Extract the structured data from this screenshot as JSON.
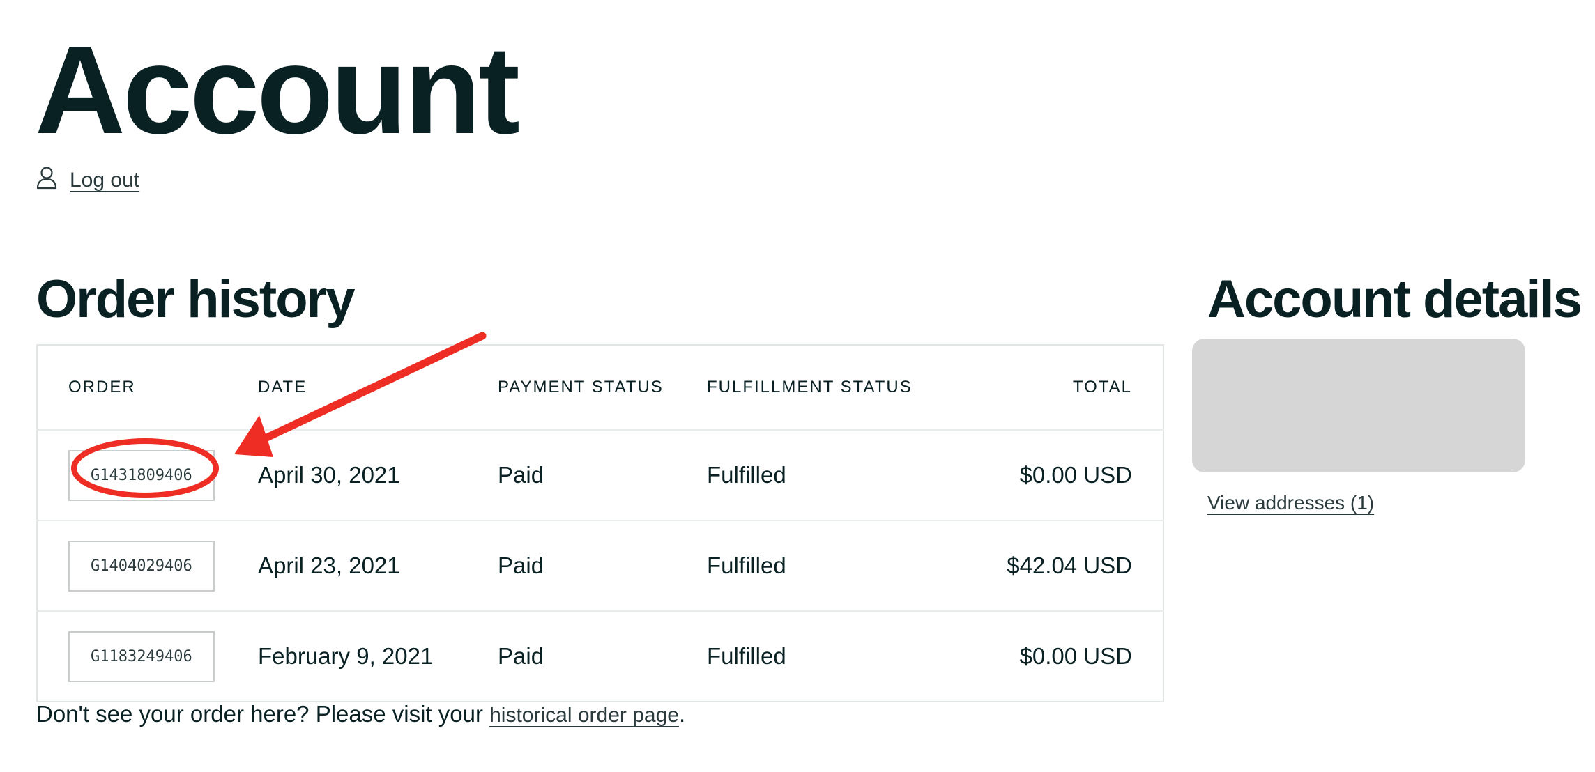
{
  "page": {
    "title": "Account"
  },
  "logout": {
    "icon": "user-icon",
    "label": "Log out"
  },
  "order_history": {
    "title": "Order history",
    "columns": {
      "order": "ORDER",
      "date": "DATE",
      "payment_status": "PAYMENT STATUS",
      "fulfillment_status": "FULFILLMENT STATUS",
      "total": "TOTAL"
    },
    "rows": [
      {
        "order": "G1431809406",
        "date": "April 30, 2021",
        "payment_status": "Paid",
        "fulfillment_status": "Fulfilled",
        "total": "$0.00 USD"
      },
      {
        "order": "G1404029406",
        "date": "April 23, 2021",
        "payment_status": "Paid",
        "fulfillment_status": "Fulfilled",
        "total": "$42.04 USD"
      },
      {
        "order": "G1183249406",
        "date": "February 9, 2021",
        "payment_status": "Paid",
        "fulfillment_status": "Fulfilled",
        "total": "$0.00 USD"
      }
    ],
    "footnote_text": "Don't see your order here? Please visit your ",
    "footnote_link": "historical order page",
    "footnote_end": "."
  },
  "account_details": {
    "title": "Account details",
    "view_addresses": "View addresses (1)"
  },
  "annotation": {
    "color": "#ee2e24",
    "shapes": [
      "red-arrow",
      "red-ellipse"
    ]
  }
}
